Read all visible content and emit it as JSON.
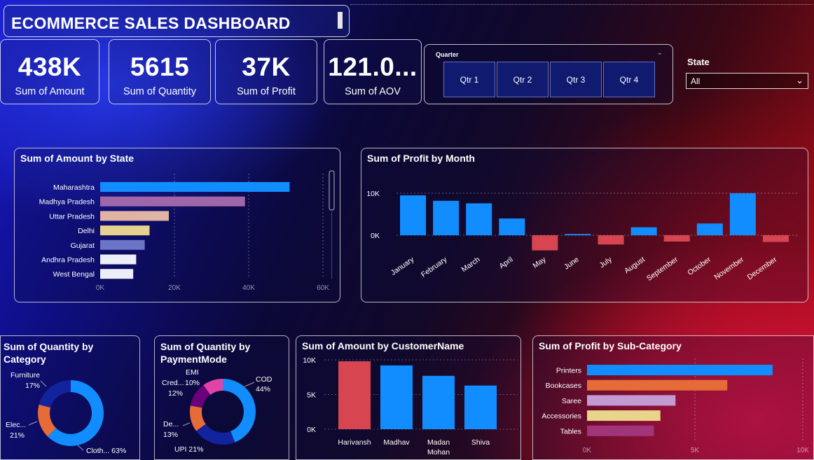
{
  "title": "ECOMMERCE SALES DASHBOARD",
  "kpis": [
    {
      "value": "438K",
      "label": "Sum of Amount"
    },
    {
      "value": "5615",
      "label": "Sum of Quantity"
    },
    {
      "value": "37K",
      "label": "Sum of Profit"
    },
    {
      "value": "121.0...",
      "label": "Sum of AOV"
    }
  ],
  "quarter_slicer": {
    "title": "Quarter",
    "options": [
      "Qtr 1",
      "Qtr 2",
      "Qtr 3",
      "Qtr 4"
    ]
  },
  "state_filter": {
    "label": "State",
    "value": "All"
  },
  "colors": {
    "blue": "#118dff",
    "red": "#d64550",
    "orange": "#e66c37"
  },
  "chart_data": [
    {
      "id": "amount-by-state",
      "type": "bar",
      "orientation": "horizontal",
      "title": "Sum of Amount by State",
      "categories": [
        "Maharashtra",
        "Madhya Pradesh",
        "Uttar Pradesh",
        "Delhi",
        "Gujarat",
        "Andhra Pradesh",
        "West Bengal"
      ],
      "values": [
        51000,
        39000,
        18500,
        13300,
        12000,
        9700,
        8900
      ],
      "colors": [
        "#118dff",
        "#a066aa",
        "#e0b4a4",
        "#e5d28e",
        "#6b74c6",
        "#eceef8",
        "#ecedf8"
      ],
      "xlim": [
        0,
        60000
      ],
      "xticks": [
        "0K",
        "20K",
        "40K",
        "60K"
      ]
    },
    {
      "id": "profit-by-month",
      "type": "bar",
      "title": "Sum of Profit by Month",
      "categories": [
        "January",
        "February",
        "March",
        "April",
        "May",
        "June",
        "July",
        "August",
        "September",
        "October",
        "November",
        "December"
      ],
      "values": [
        9500,
        8200,
        7600,
        4000,
        -3600,
        300,
        -2200,
        1900,
        -1500,
        2800,
        10000,
        -1600
      ],
      "ylim": [
        -4000,
        11000
      ],
      "yticks": [
        "0K",
        "10K"
      ]
    },
    {
      "id": "quantity-by-category",
      "type": "pie",
      "title": "Sum of Quantity by Category",
      "labels": [
        "Clothing",
        "Furniture",
        "Electronics"
      ],
      "display_labels": [
        "Cloth...",
        "Furniture",
        "Elec..."
      ],
      "values": [
        63,
        17,
        21
      ],
      "percent_labels": [
        "63%",
        "17%",
        "21%"
      ],
      "colors": [
        "#118dff",
        "#e66c37",
        "#12239e"
      ]
    },
    {
      "id": "quantity-by-paymentmode",
      "type": "pie",
      "title": "Sum of Quantity by PaymentMode",
      "labels": [
        "COD",
        "UPI",
        "Debit Card",
        "Credit Card",
        "EMI"
      ],
      "display_labels": [
        "COD",
        "UPI",
        "De...",
        "Cred...",
        "EMI"
      ],
      "values": [
        44,
        21,
        13,
        12,
        10
      ],
      "percent_labels": [
        "44%",
        "21%",
        "13%",
        "12%",
        "10%"
      ],
      "colors": [
        "#118dff",
        "#12239e",
        "#e66c37",
        "#6b007b",
        "#e044a7"
      ]
    },
    {
      "id": "amount-by-customer",
      "type": "bar",
      "title": "Sum of Amount by CustomerName",
      "categories": [
        "Harivansh",
        "Madhav",
        "Madan Mohan",
        "Shiva"
      ],
      "values": [
        9800,
        9200,
        7700,
        6300
      ],
      "ylim": [
        0,
        10000
      ],
      "yticks": [
        "0K",
        "5K",
        "10K"
      ]
    },
    {
      "id": "profit-by-subcategory",
      "type": "bar",
      "orientation": "horizontal",
      "title": "Sum of Profit by Sub-Category",
      "categories": [
        "Printers",
        "Bookcases",
        "Saree",
        "Accessories",
        "Tables"
      ],
      "values": [
        8600,
        6500,
        4100,
        3400,
        3100
      ],
      "colors": [
        "#118dff",
        "#e66c37",
        "#c39bd3",
        "#e8d48a",
        "#a1347b"
      ],
      "xlim": [
        0,
        10000
      ],
      "xticks": [
        "0K",
        "5K",
        "10K"
      ]
    }
  ]
}
